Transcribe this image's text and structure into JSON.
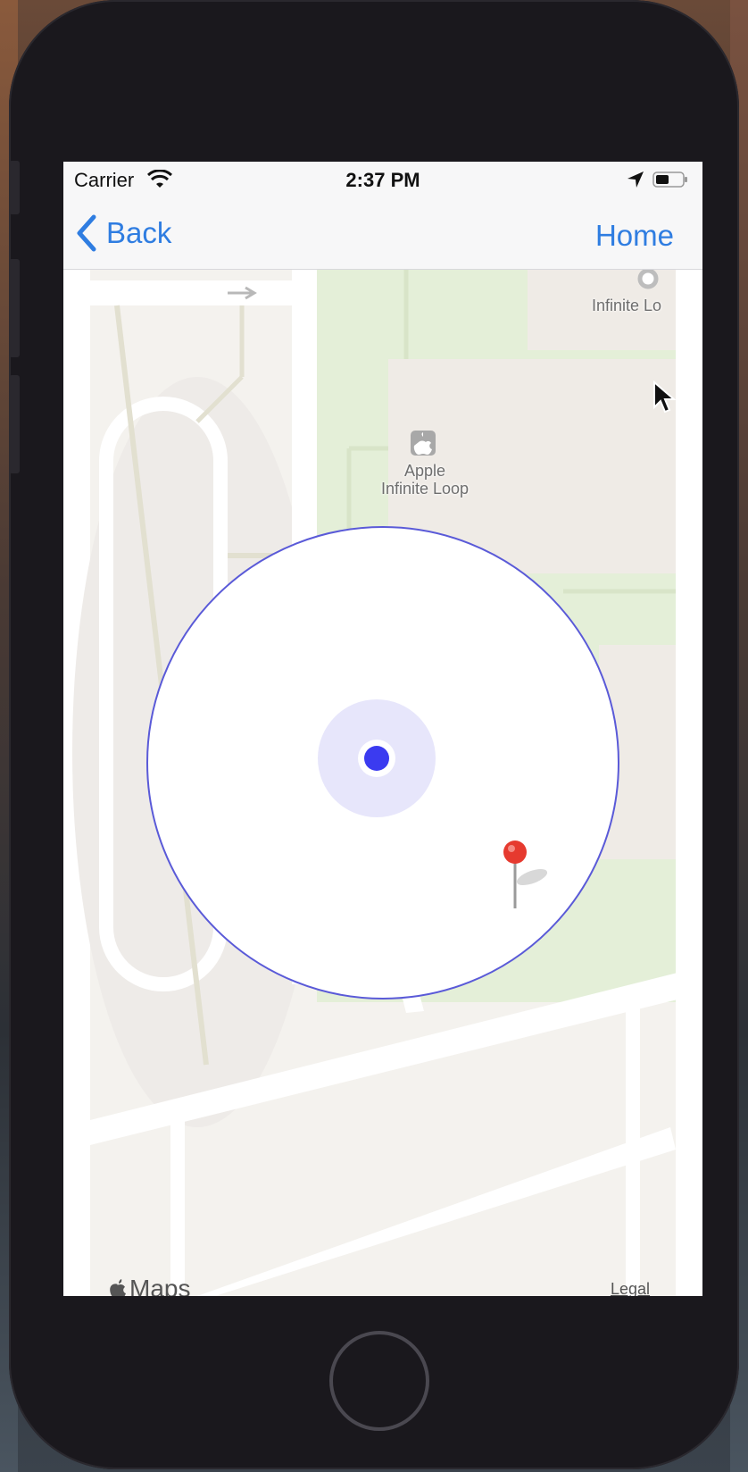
{
  "status_bar": {
    "carrier": "Carrier",
    "time": "2:37 PM",
    "wifi_icon": "wifi-icon",
    "location_icon": "location-arrow-icon",
    "battery_icon": "battery-icon"
  },
  "nav_bar": {
    "back_label": "Back",
    "home_label": "Home",
    "accent_color": "#2f7de1"
  },
  "map": {
    "poi_apple": [
      "Apple",
      "Infinite Loop"
    ],
    "poi_infinite": "Infinite Lo",
    "maps_logo": "Maps",
    "legal_label": "Legal",
    "region_circle_color": "#5a5ad8",
    "user_location_color": "#3b3bf0",
    "pin_color": "#e63a2f"
  }
}
